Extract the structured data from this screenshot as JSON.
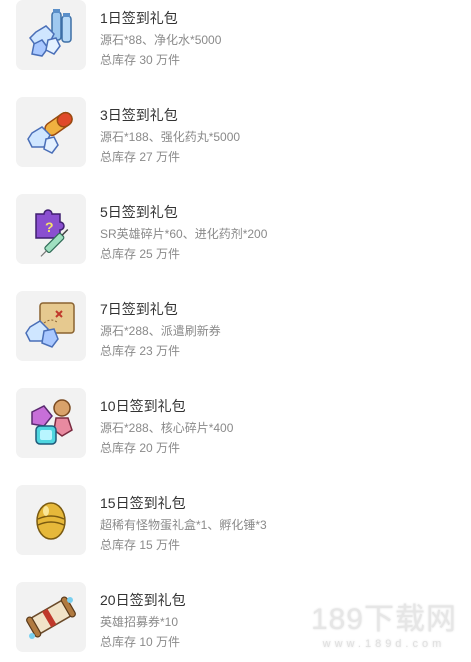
{
  "items": [
    {
      "title": "1日签到礼包",
      "desc": "源石*88、净化水*5000",
      "stock": "总库存 30 万件",
      "icon": "crystals-water-bottles-icon"
    },
    {
      "title": "3日签到礼包",
      "desc": "源石*188、强化药丸*5000",
      "stock": "总库存 27 万件",
      "icon": "crystals-pill-icon"
    },
    {
      "title": "5日签到礼包",
      "desc": "SR英雄碎片*60、进化药剂*200",
      "stock": "总库存 25 万件",
      "icon": "puzzle-syringe-icon"
    },
    {
      "title": "7日签到礼包",
      "desc": "源石*288、派遣刷新券",
      "stock": "总库存 23 万件",
      "icon": "crystals-map-icon"
    },
    {
      "title": "10日签到礼包",
      "desc": "源石*288、核心碎片*400",
      "stock": "总库存 20 万件",
      "icon": "gems-cores-icon"
    },
    {
      "title": "15日签到礼包",
      "desc": "超稀有怪物蛋礼盒*1、孵化锤*3",
      "stock": "总库存 15 万件",
      "icon": "golden-egg-icon"
    },
    {
      "title": "20日签到礼包",
      "desc": "英雄招募券*10",
      "stock": "总库存 10 万件",
      "icon": "scroll-ticket-icon"
    }
  ],
  "watermark": {
    "main": "189下载网",
    "sub": "www.189d.com"
  }
}
